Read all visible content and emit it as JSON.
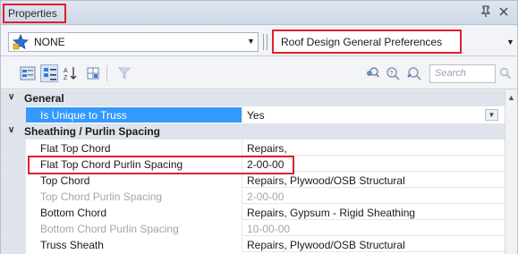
{
  "panel": {
    "title": "Properties",
    "pin_glyph": "↕",
    "close_glyph": "×"
  },
  "selector": {
    "left_value": "NONE",
    "left_icon": "star-icon",
    "right_value": "Roof Design General Preferences"
  },
  "toolbar": {
    "search_placeholder": "Search",
    "icons": [
      "categorized-icon",
      "alphabetical-icon",
      "sort-az-icon",
      "property-pages-icon",
      "filter-icon",
      "find-icon",
      "clear-find-icon",
      "find-next-icon",
      "search-icon"
    ]
  },
  "grid": {
    "categories": [
      {
        "label": "General"
      },
      {
        "label": "Sheathing / Purlin Spacing"
      }
    ],
    "general_rows": [
      {
        "name": "Is Unique to Truss",
        "value": "Yes"
      }
    ],
    "sheathing_rows": [
      {
        "name": "Flat Top Chord",
        "value": "Repairs,"
      },
      {
        "name": "Flat Top Chord Purlin Spacing",
        "value": "2-00-00"
      },
      {
        "name": "Top Chord",
        "value": "Repairs, Plywood/OSB Structural"
      },
      {
        "name": "Top Chord Purlin Spacing",
        "value": "2-00-00"
      },
      {
        "name": "Bottom Chord",
        "value": "Repairs, Gypsum - Rigid Sheathing"
      },
      {
        "name": "Bottom Chord Purlin Spacing",
        "value": "10-00-00"
      },
      {
        "name": "Truss Sheath",
        "value": "Repairs, Plywood/OSB Structural"
      }
    ]
  },
  "colors": {
    "highlight": "#e0202e",
    "selection": "#3399ff",
    "category_bg": "#dfe4ec"
  }
}
